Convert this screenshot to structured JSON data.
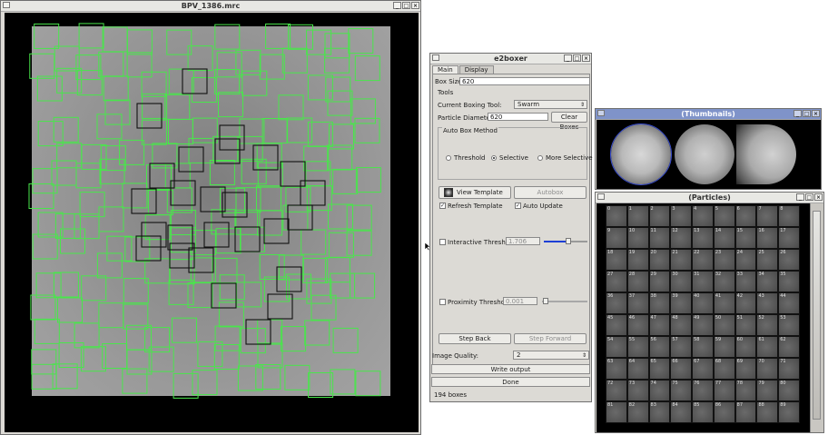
{
  "bpv_window": {
    "title": "BPV_1386.mrc"
  },
  "e2boxer": {
    "title": "e2boxer",
    "tabs": [
      "Main",
      "Display"
    ],
    "box_size_label": "Box Size:",
    "box_size_value": "620",
    "tools_label": "Tools",
    "current_boxing_tool_label": "Current Boxing Tool:",
    "current_boxing_tool_value": "Swarm",
    "particle_diameter_label": "Particle Diameter:",
    "particle_diameter_value": "620",
    "clear_boxes": "Clear Boxes",
    "auto_box_method": "Auto Box Method",
    "radio_threshold": "Threshold",
    "radio_selective": "Selective",
    "radio_more_selective": "More Selective",
    "view_template": "View Template",
    "autobox": "Autobox",
    "refresh_template": "Refresh Template",
    "auto_update": "Auto Update",
    "interactive_threshold_label": "Interactive Threshold",
    "interactive_threshold_value": "1.706",
    "proximity_threshold_label": "Proximity Threshold",
    "proximity_threshold_value": "0.001",
    "step_back": "Step Back",
    "step_forward": "Step Forward",
    "image_quality_label": "Image Quality:",
    "image_quality_value": "2",
    "write_output": "Write output",
    "done": "Done",
    "status": "194 boxes"
  },
  "thumbnails_window": {
    "title": "(Thumbnails)"
  },
  "particles_window": {
    "title": "(Particles)",
    "labels": [
      "0",
      "1",
      "2",
      "3",
      "4",
      "5",
      "6",
      "7",
      "8",
      "9",
      "10",
      "11",
      "12",
      "13",
      "14",
      "15",
      "16",
      "17",
      "18",
      "19",
      "20",
      "21",
      "22",
      "23",
      "24",
      "25",
      "26",
      "27",
      "28",
      "29",
      "30",
      "31",
      "32",
      "33",
      "34",
      "35",
      "36",
      "37",
      "38",
      "39",
      "40",
      "41",
      "42",
      "43",
      "44",
      "45",
      "46",
      "47",
      "48",
      "49",
      "50",
      "51",
      "52",
      "53",
      "54",
      "55",
      "56",
      "57",
      "58",
      "59",
      "60",
      "61",
      "62",
      "63",
      "64",
      "65",
      "66",
      "67",
      "68",
      "69",
      "70",
      "71",
      "72",
      "73",
      "74",
      "75",
      "76",
      "77",
      "78",
      "79",
      "80",
      "81",
      "82",
      "83",
      "84",
      "85",
      "86",
      "87",
      "88",
      "89"
    ]
  },
  "colors": {
    "box_green": "#49e64b",
    "box_black": "#111111",
    "titlebar_active": "#7f93c9"
  }
}
